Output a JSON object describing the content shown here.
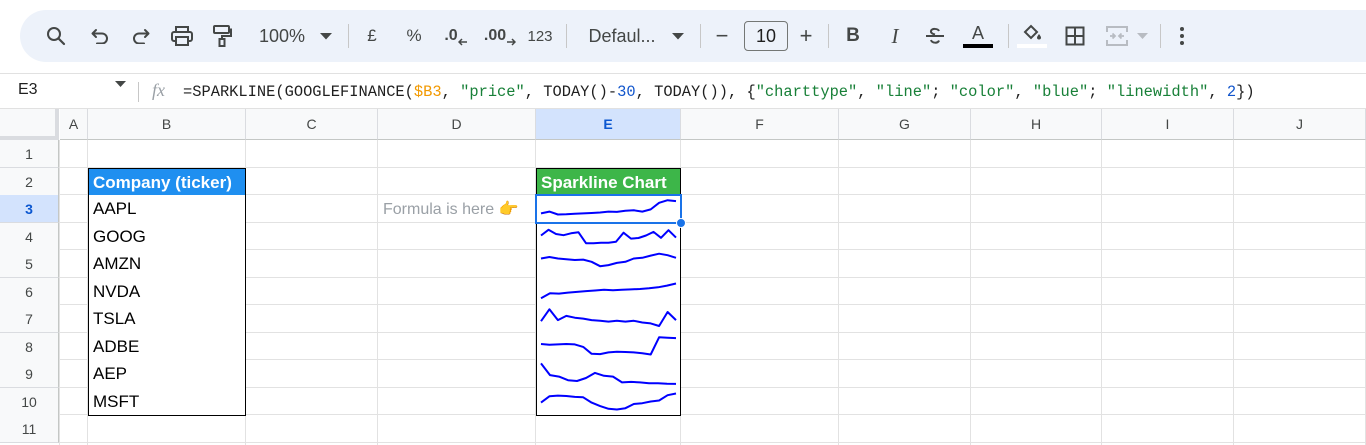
{
  "toolbar": {
    "zoom": "100%",
    "currency_symbol": "£",
    "percent_symbol": "%",
    "decrease_decimal": ".0",
    "increase_decimal": ".00",
    "number_format": "123",
    "font": "Defaul...",
    "font_size": "10",
    "minus": "−",
    "plus": "+",
    "bold": "B",
    "italic": "I",
    "text_color": "A"
  },
  "formula_bar": {
    "cell_ref": "E3",
    "fx_label": "fx",
    "formula_parts": {
      "p1": "=SPARKLINE(GOOGLEFINANCE(",
      "ref": "$B3",
      "p2": ", ",
      "s1": "\"price\"",
      "p3": ", TODAY()-",
      "n1": "30",
      "p4": ", TODAY()), {",
      "s2": "\"charttype\"",
      "p5": ", ",
      "s3": "\"line\"",
      "p6": "; ",
      "s4": "\"color\"",
      "p7": ", ",
      "s5": "\"blue\"",
      "p8": "; ",
      "s6": "\"linewidth\"",
      "p9": ", ",
      "n2": "2",
      "p10": "})"
    }
  },
  "columns": [
    "A",
    "B",
    "C",
    "D",
    "E",
    "F",
    "G",
    "H",
    "I",
    "J"
  ],
  "rows": [
    "1",
    "2",
    "3",
    "4",
    "5",
    "6",
    "7",
    "8",
    "9",
    "10",
    "11"
  ],
  "selected": {
    "column": "E",
    "row": "3"
  },
  "sheet": {
    "company_header": "Company (ticker)",
    "sparkline_header": "Sparkline Chart",
    "note": "Formula is here 👉",
    "tickers": [
      "AAPL",
      "GOOG",
      "AMZN",
      "NVDA",
      "TSLA",
      "ADBE",
      "AEP",
      "MSFT"
    ]
  },
  "colors": {
    "company_header_bg": "#1f8ff0",
    "sparkline_header_bg": "#3db649",
    "sparkline_line": "#0000ff",
    "selection": "#1a73e8"
  },
  "sparklines": [
    {
      "ticker": "AAPL",
      "values": [
        0.7,
        0.62,
        0.75,
        0.74,
        0.72,
        0.7,
        0.68,
        0.66,
        0.62,
        0.63,
        0.58,
        0.56,
        0.62,
        0.52,
        0.22,
        0.1,
        0.14
      ]
    },
    {
      "ticker": "GOOG",
      "values": [
        0.45,
        0.18,
        0.38,
        0.44,
        0.35,
        0.3,
        0.82,
        0.82,
        0.8,
        0.8,
        0.75,
        0.32,
        0.6,
        0.57,
        0.45,
        0.28,
        0.56,
        0.2,
        0.55
      ]
    },
    {
      "ticker": "AMZN",
      "values": [
        0.25,
        0.18,
        0.25,
        0.28,
        0.32,
        0.3,
        0.4,
        0.6,
        0.55,
        0.45,
        0.4,
        0.25,
        0.22,
        0.12,
        0.03,
        0.1,
        0.22
      ]
    },
    {
      "ticker": "NVDA",
      "values": [
        0.82,
        0.58,
        0.6,
        0.55,
        0.52,
        0.48,
        0.45,
        0.42,
        0.44,
        0.42,
        0.4,
        0.38,
        0.35,
        0.3,
        0.22,
        0.12
      ]
    },
    {
      "ticker": "TSLA",
      "values": [
        0.6,
        0.06,
        0.55,
        0.36,
        0.44,
        0.48,
        0.55,
        0.58,
        0.62,
        0.58,
        0.62,
        0.58,
        0.66,
        0.7,
        0.82,
        0.18,
        0.55
      ]
    },
    {
      "ticker": "ADBE",
      "values": [
        0.38,
        0.42,
        0.4,
        0.38,
        0.4,
        0.52,
        0.85,
        0.86,
        0.78,
        0.75,
        0.76,
        0.78,
        0.82,
        0.88,
        0.06,
        0.08,
        0.1
      ]
    },
    {
      "ticker": "AEP",
      "values": [
        0.02,
        0.55,
        0.62,
        0.78,
        0.82,
        0.68,
        0.45,
        0.58,
        0.62,
        0.88,
        0.86,
        0.88,
        0.92,
        0.92,
        0.94,
        0.95
      ]
    },
    {
      "ticker": "MSFT",
      "values": [
        0.55,
        0.25,
        0.22,
        0.24,
        0.28,
        0.3,
        0.55,
        0.72,
        0.85,
        0.88,
        0.82,
        0.62,
        0.58,
        0.5,
        0.45,
        0.2,
        0.12
      ]
    }
  ]
}
